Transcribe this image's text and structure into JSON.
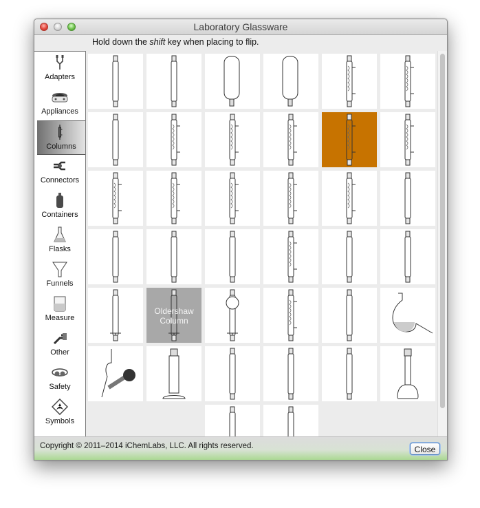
{
  "window": {
    "title": "Laboratory Glassware",
    "hint_prefix": "Hold down the ",
    "hint_emphasis": "shift",
    "hint_suffix": " key when placing to flip."
  },
  "sidebar": {
    "selected": "Columns",
    "items": [
      {
        "label": "Adapters",
        "icon": "adapter-icon"
      },
      {
        "label": "Appliances",
        "icon": "hot-plate-icon"
      },
      {
        "label": "Columns",
        "icon": "column-icon"
      },
      {
        "label": "Connectors",
        "icon": "connector-icon"
      },
      {
        "label": "Containers",
        "icon": "bottle-icon"
      },
      {
        "label": "Flasks",
        "icon": "flask-icon"
      },
      {
        "label": "Funnels",
        "icon": "funnel-icon"
      },
      {
        "label": "Measure",
        "icon": "beaker-icon"
      },
      {
        "label": "Other",
        "icon": "faucet-icon"
      },
      {
        "label": "Safety",
        "icon": "goggles-icon"
      },
      {
        "label": "Symbols",
        "icon": "radiation-icon"
      }
    ]
  },
  "grid": {
    "selected_tile_index": 10,
    "hovered_tile_index": 25,
    "hover_tooltip_line1": "Oldershaw",
    "hover_tooltip_line2": "Column",
    "tiles": [
      "tube",
      "column-plain",
      "jacketed-flask",
      "cold-trap",
      "coil-condenser",
      "dimroth-coil",
      "side-arm-column",
      "coil-condenser-2",
      "coil-lower",
      "allihn-condenser",
      "liebig-condenser",
      "allihn-coil-top",
      "liebig-short",
      "graham-condenser",
      "west-condenser",
      "plain-condenser",
      "vigreux-jacket",
      "reflux-head",
      "bent-column",
      "oldershaw-column",
      "packed-column",
      "vigreux-column",
      "snyder-column",
      "plain-column-2",
      "chromatography-column",
      "chromatography-packed",
      "reservoir-column",
      "jacketed-vigreux",
      "soxhlet-extractor",
      "retort",
      "drying-column",
      "cylinder-column",
      "gas-bubbler",
      "gas-inlet-tube",
      "fritted-tube",
      "bottle-base",
      "",
      "",
      "dropper-column",
      "thin-tube"
    ]
  },
  "scrollbar": {
    "position": 0.0
  },
  "footer": {
    "copyright": "Copyright © 2011–2014 iChemLabs, LLC. All rights reserved.",
    "close_label": "Close"
  }
}
